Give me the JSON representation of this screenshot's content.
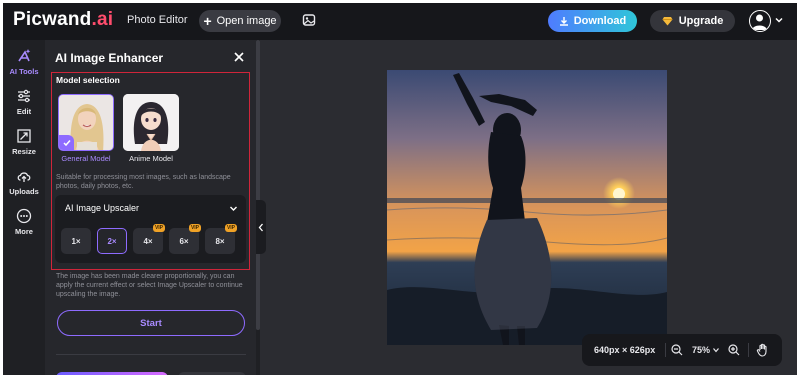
{
  "header": {
    "logo_main": "Picwand",
    "logo_suffix": ".ai",
    "nav_photo_editor": "Photo Editor",
    "open_image_label": "Open image",
    "download_label": "Download",
    "upgrade_label": "Upgrade"
  },
  "rail": {
    "items": [
      {
        "label": "AI Tools",
        "icon": "ai-tools-icon",
        "active": true
      },
      {
        "label": "Edit",
        "icon": "sliders-icon"
      },
      {
        "label": "Resize",
        "icon": "resize-icon"
      },
      {
        "label": "Uploads",
        "icon": "upload-cloud-icon"
      },
      {
        "label": "More",
        "icon": "more-icon"
      }
    ]
  },
  "panel": {
    "title": "AI Image Enhancer",
    "model_selection_label": "Model selection",
    "models": [
      {
        "label": "General Model",
        "selected": true
      },
      {
        "label": "Anime Model",
        "selected": false
      }
    ],
    "model_description": "Suitable for processing most images, such as landscape photos, daily photos, etc.",
    "upscaler": {
      "title": "AI Image Upscaler",
      "options": [
        {
          "label": "1×",
          "vip": false,
          "selected": false
        },
        {
          "label": "2×",
          "vip": false,
          "selected": true
        },
        {
          "label": "4×",
          "vip": true,
          "selected": false
        },
        {
          "label": "6×",
          "vip": true,
          "selected": false
        },
        {
          "label": "8×",
          "vip": true,
          "selected": false
        }
      ],
      "vip_badge": "VIP"
    },
    "note": "The image has been made clearer proportionally, you can apply the current effect or select Image Upscaler to continue upscaling the image.",
    "start_label": "Start"
  },
  "zoom": {
    "dimensions": "640px × 626px",
    "level": "75%"
  },
  "colors": {
    "accent": "#8e6bff",
    "highlight_box": "#d0253a",
    "download_gradient_start": "#4f7cff",
    "download_gradient_end": "#2fc6d9",
    "vip": "#f0a226"
  }
}
